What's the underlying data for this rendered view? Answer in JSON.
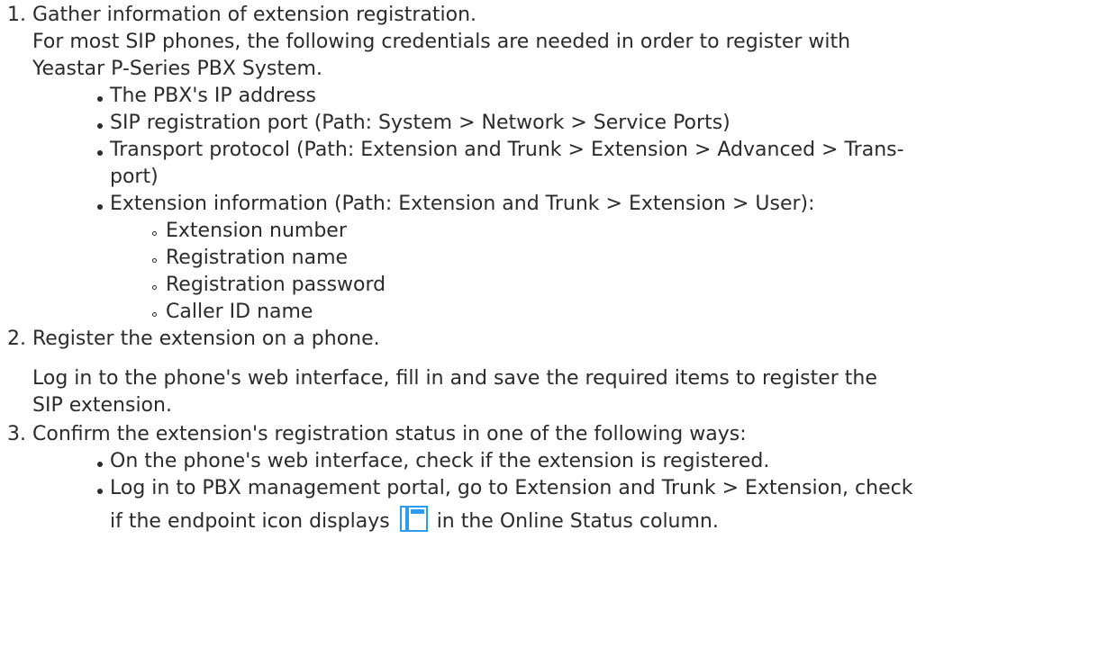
{
  "steps": [
    {
      "number": "1.",
      "title": "Gather information of extension registration.",
      "text_line1": "For most SIP phones, the following credentials are needed in order to register with",
      "text_line2": "Yeastar P-Series PBX System.",
      "bullets": [
        "The PBX's IP address",
        "SIP registration port (Path: System > Network > Service Ports)",
        "Transport protocol (Path: Extension and Trunk > Extension > Advanced > Trans-",
        "port)",
        "Extension information (Path: Extension and Trunk > Extension > User):"
      ],
      "sub_bullets": [
        "Extension number",
        "Registration name",
        "Registration password",
        "Caller ID name"
      ]
    },
    {
      "number": "2.",
      "title": "Register the extension on a phone.",
      "text_line1": "Log in to the phone's web interface, fill in and save the required items to register the",
      "text_line2": "SIP extension."
    },
    {
      "number": "3.",
      "title": "Confirm the extension's registration status in one of the following ways:",
      "bullets": [
        "On the phone's web interface, check if the extension is registered.",
        "Log in to PBX management portal, go to Extension and Trunk > Extension, check"
      ],
      "last_before_icon": "if the endpoint icon displays",
      "last_after_icon": "in the Online Status column."
    }
  ],
  "icon": "endpoint-online-icon",
  "icon_color": "#2f9bf0"
}
